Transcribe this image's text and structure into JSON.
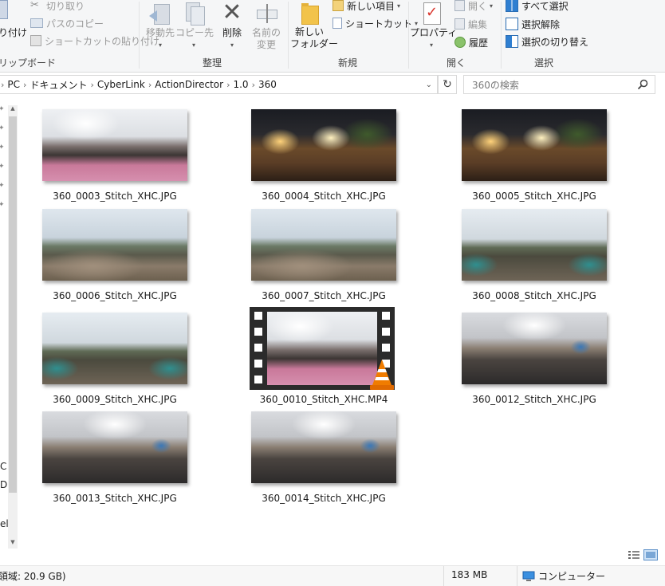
{
  "ribbon": {
    "clipboard": {
      "label": "リップボード",
      "paste_fragment": "り付け",
      "cut": "切り取り",
      "copy_path": "パスのコピー",
      "paste_shortcut": "ショートカットの貼り付け"
    },
    "organize": {
      "label": "整理",
      "move_to": "移動先",
      "copy_to": "コピー先",
      "delete": "削除",
      "rename_line1": "名前の",
      "rename_line2": "変更"
    },
    "new": {
      "label": "新規",
      "new_folder_line1": "新しい",
      "new_folder_line2": "フォルダー",
      "new_item": "新しい項目",
      "shortcut": "ショートカット"
    },
    "open": {
      "label": "開く",
      "properties": "プロパティ",
      "open": "開く",
      "edit": "編集",
      "history": "履歴"
    },
    "select": {
      "label": "選択",
      "select_all": "すべて選択",
      "select_none": "選択解除",
      "invert": "選択の切り替え"
    }
  },
  "address": {
    "breadcrumbs": [
      "PC",
      "ドキュメント",
      "CyberLink",
      "ActionDirector",
      "1.0",
      "360"
    ],
    "search_placeholder": "360の検索"
  },
  "nav": {
    "fragments": [
      "C",
      "D",
      "el"
    ]
  },
  "files": [
    {
      "name": "360_0003_Stitch_XHC.JPG",
      "kind": "indoor-pink"
    },
    {
      "name": "360_0004_Stitch_XHC.JPG",
      "kind": "night"
    },
    {
      "name": "360_0005_Stitch_XHC.JPG",
      "kind": "night"
    },
    {
      "name": "360_0006_Stitch_XHC.JPG",
      "kind": "hill"
    },
    {
      "name": "360_0007_Stitch_XHC.JPG",
      "kind": "hill"
    },
    {
      "name": "360_0008_Stitch_XHC.JPG",
      "kind": "hill2"
    },
    {
      "name": "360_0009_Stitch_XHC.JPG",
      "kind": "hill2"
    },
    {
      "name": "360_0010_Stitch_XHC.MP4",
      "kind": "video"
    },
    {
      "name": "360_0012_Stitch_XHC.JPG",
      "kind": "office"
    },
    {
      "name": "360_0013_Stitch_XHC.JPG",
      "kind": "office"
    },
    {
      "name": "360_0014_Stitch_XHC.JPG",
      "kind": "office"
    }
  ],
  "status": {
    "free_space": "領域: 20.9 GB)",
    "size": "183 MB",
    "computer": "コンピューター"
  },
  "colors": {
    "accent_blue": "#1e73be",
    "ribbon_bg": "#f5f6f7",
    "vlc_orange": "#f07c00"
  },
  "icons": {
    "search": "magnifier-icon",
    "refresh": "refresh-icon",
    "details_view": "details-view-icon",
    "large_icons_view": "large-icons-view-icon"
  }
}
